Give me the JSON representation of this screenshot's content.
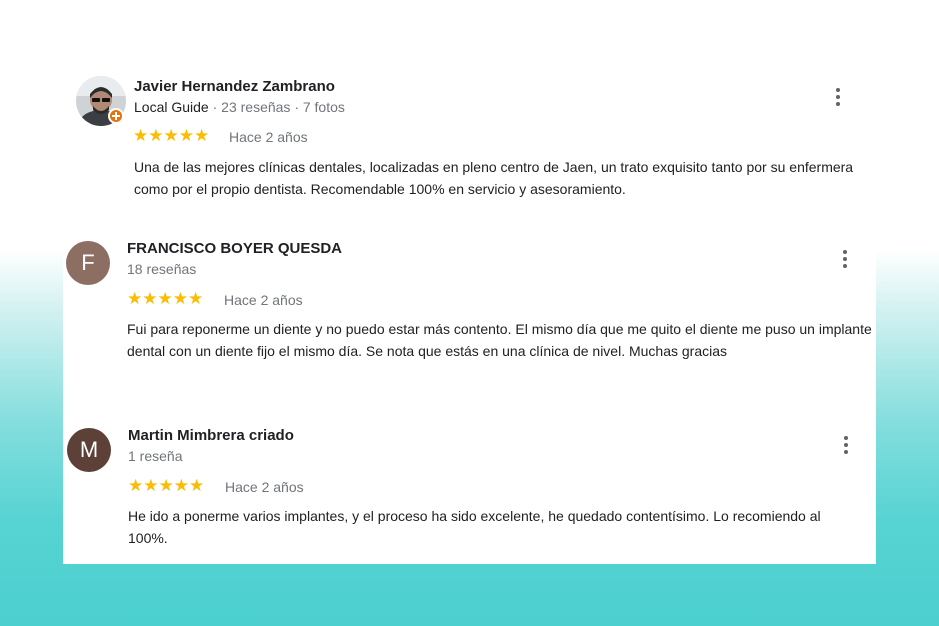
{
  "reviews": [
    {
      "author": "Javier Hernandez Zambrano",
      "guide_label": "Local Guide",
      "meta": " · 23 reseñas · 7 fotos",
      "stars": "★★★★★",
      "rating": 5,
      "date": "Hace 2 años",
      "text": "Una de las mejores clínicas dentales, localizadas en pleno centro de Jaen, un trato exquisito tanto por su enfermera como por el propio dentista. Recomendable 100% en servicio y asesoramiento.",
      "avatar_icon": "user-photo",
      "badge_icon": "local-guide-badge-icon"
    },
    {
      "author": "FRANCISCO BOYER QUESDA",
      "meta": "18 reseñas",
      "initial": "F",
      "avatar_color": "#8d6e63",
      "stars": "★★★★★",
      "rating": 5,
      "date": "Hace 2 años",
      "text": "Fui para reponerme un diente y no puedo estar más contento. El mismo día que me quito el diente me puso un implante dental con un diente fijo el mismo día. Se nota que estás en una clínica de nivel. Muchas gracias"
    },
    {
      "author": "Martin Mimbrera criado",
      "meta": "1 reseña",
      "initial": "M",
      "avatar_color": "#5d4037",
      "stars": "★★★★★",
      "rating": 5,
      "date": "Hace 2 años",
      "text": "He ido a ponerme varios implantes, y el proceso ha sido excelente, he quedado contentísimo. Lo recomiendo al 100%."
    }
  ],
  "colors": {
    "star": "#fbbc04",
    "background_bottom": "#4ccfcf"
  },
  "menu_icon": "more-vert-icon"
}
